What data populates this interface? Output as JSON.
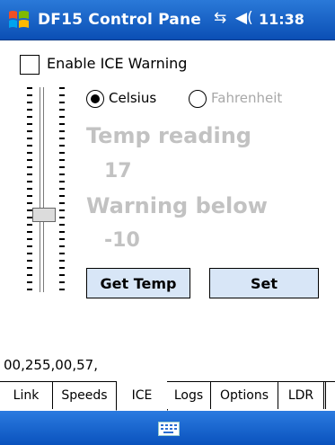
{
  "titlebar": {
    "title": "DF15 Control Pane",
    "time": "11:38",
    "connection_icon": "connectivity-arrows-icon",
    "volume_icon": "speaker-icon"
  },
  "ice": {
    "enable_warning_label": "Enable ICE Warning",
    "enable_warning_checked": false,
    "unit_celsius": "Celsius",
    "unit_fahrenheit": "Fahrenheit",
    "selected_unit": "Celsius",
    "temp_reading_label": "Temp reading",
    "temp_reading_value": "17",
    "warning_below_label": "Warning below",
    "warning_below_value": "-10",
    "get_temp_button": "Get Temp",
    "set_button": "Set",
    "slider_level": 0.37,
    "readout": "00,255,00,57,"
  },
  "tabs": [
    "Link",
    "Speeds",
    "ICE",
    "Logs",
    "Options",
    "LDR"
  ],
  "active_tab": "ICE",
  "colors": {
    "title_bar": "#1866cc",
    "button_fill": "#d8e6f7",
    "disabled_text": "#c2c2c2"
  }
}
